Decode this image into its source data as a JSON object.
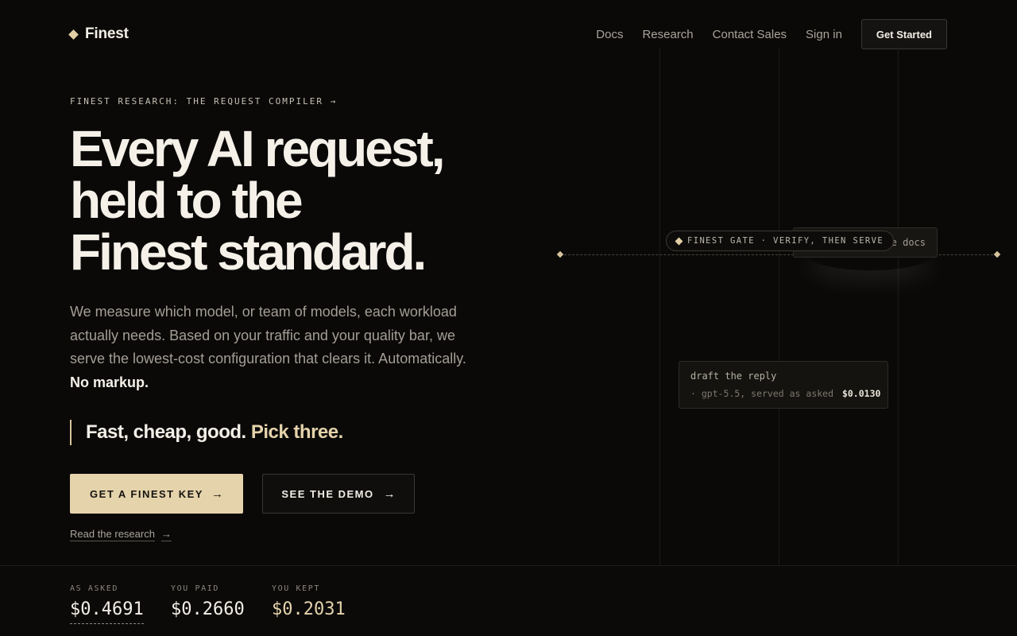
{
  "header": {
    "brand": "Finest",
    "nav": [
      "Docs",
      "Research",
      "Contact Sales",
      "Sign in"
    ],
    "cta": "Get Started"
  },
  "hero": {
    "eyebrow": "FINEST RESEARCH: THE REQUEST COMPILER →",
    "headline_lines": [
      "Every AI request,",
      "held to the",
      "Finest standard."
    ],
    "lead": "We measure which model, or team of models, each workload actually needs. Based on your traffic and your quality bar, we serve the lowest-cost configuration that clears it. Automatically.",
    "lead_strong": "No markup.",
    "pull_main": "Fast, cheap, good.",
    "pull_accent": "Pick three.",
    "primary_button": "GET A FINEST KEY",
    "secondary_button": "SEE THE DEMO",
    "read_link": "Read the research",
    "arrow": "→"
  },
  "visual": {
    "gate_label": "FINEST GATE · VERIFY, THEN SERVE",
    "docs_card_text": "e docs",
    "request_card": {
      "title": "draft the reply",
      "detail": "· gpt-5.5, served as asked",
      "price": "$0.0130"
    }
  },
  "stats": [
    {
      "label": "AS ASKED",
      "value": "$0.4691"
    },
    {
      "label": "YOU PAID",
      "value": "$0.2660"
    },
    {
      "label": "YOU KEPT",
      "value": "$0.2031"
    }
  ],
  "colors": {
    "background": "#0a0908",
    "accent": "#e5d3ab",
    "text": "#f3efe7",
    "muted": "#a49e95"
  }
}
